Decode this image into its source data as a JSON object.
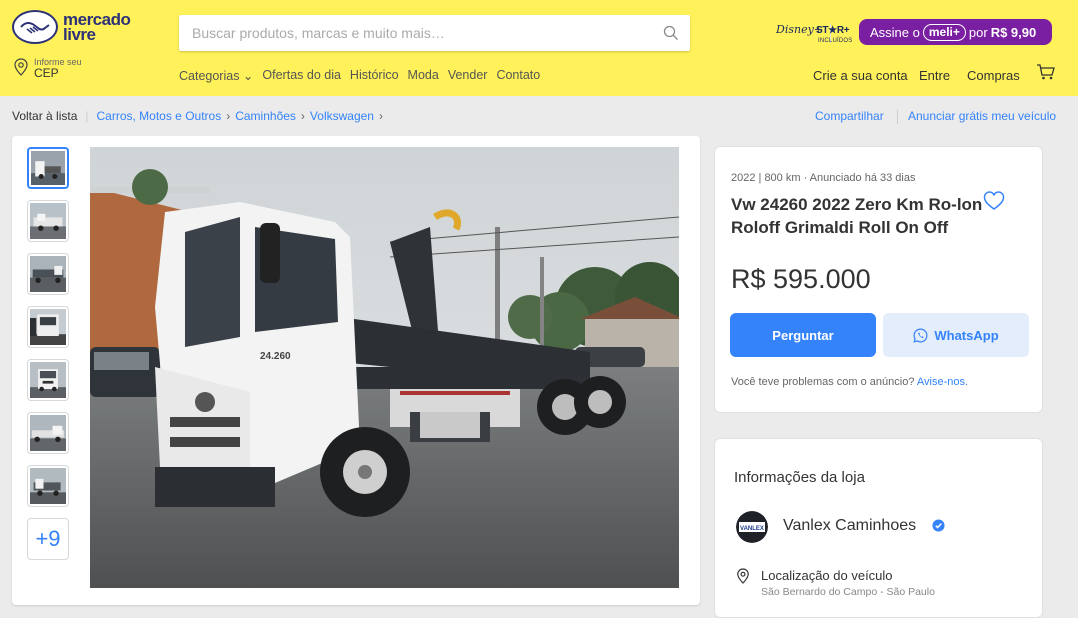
{
  "header": {
    "logo_text_1": "mercado",
    "logo_text_2": "livre",
    "search_placeholder": "Buscar produtos, marcas e muito mais…",
    "disney": {
      "brand": "Disney+",
      "star": "ST★R+",
      "sub": "INCLUÍDOS"
    },
    "promo": {
      "prefix": "Assine o",
      "badge": "meli+",
      "mid": "por",
      "price": "R$ 9,90",
      "color": "#7b1fa2"
    },
    "location": {
      "label": "Informe seu",
      "value": "CEP"
    },
    "nav": [
      "Categorias ⌄",
      "Ofertas do dia",
      "Histórico",
      "Moda",
      "Vender",
      "Contato"
    ],
    "account": {
      "create": "Crie a sua conta",
      "login": "Entre",
      "purchases": "Compras"
    },
    "bg_color": "#fff159"
  },
  "breadcrumb": {
    "back": "Voltar à lista",
    "items": [
      "Carros, Motos e Outros",
      "Caminhões",
      "Volkswagen"
    ],
    "share": "Compartilhar",
    "advertise": "Anunciar grátis meu veículo"
  },
  "gallery": {
    "more_label": "+9",
    "thumbnail_count": 7
  },
  "listing": {
    "meta": "2022 | 800 km · Anunciado há 33 dias",
    "title": "Vw 24260 2022 Zero Km Ro-lon Roloff Grimaldi Roll On Off",
    "price": "R$ 595.000",
    "ask_label": "Perguntar",
    "whatsapp_label": "WhatsApp",
    "report_text": "Você teve problemas com o anúncio?",
    "report_link": "Avise-nos.",
    "truck_model_text": "24.260",
    "accent": "#3483fa"
  },
  "store": {
    "heading": "Informações da loja",
    "logo_text": "VANLEX",
    "name": "Vanlex Caminhoes",
    "location_label": "Localização do veículo",
    "location_value": "São Bernardo do Campo - São Paulo"
  }
}
